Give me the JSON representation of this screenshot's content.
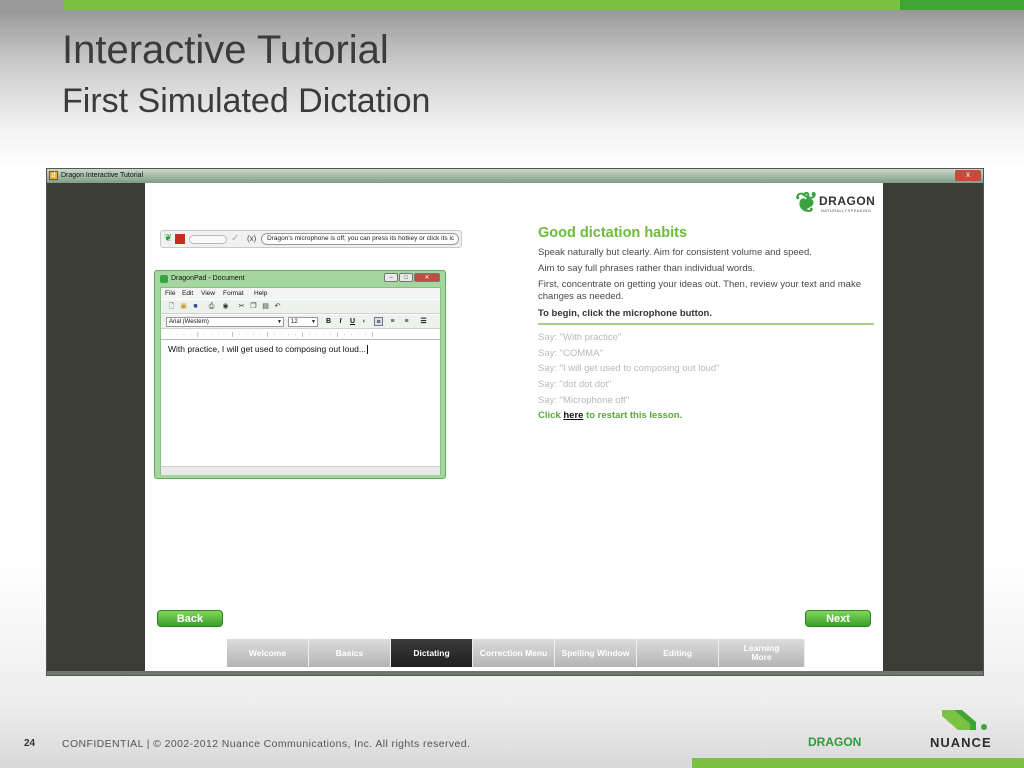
{
  "slide": {
    "title": "Interactive Tutorial",
    "subtitle": "First Simulated Dictation",
    "page_number": "24",
    "footer": "CONFIDENTIAL | © 2002-2012 Nuance Communications, Inc. All rights reserved.",
    "footer_brand": "DRAGON",
    "company": "NUANCE"
  },
  "window": {
    "title": "Dragon Interactive Tutorial",
    "close_label": "x"
  },
  "mic_bar": {
    "status_message": "Dragon's microphone is off; you can press its hotkey or click its ic",
    "x_label": "(x)"
  },
  "dragonpad": {
    "title": "DragonPad - Document",
    "menu": [
      "File",
      "Edit",
      "View",
      "Format",
      "Help"
    ],
    "font": "Arial (Western)",
    "font_size": "12",
    "format_buttons": [
      "B",
      "I",
      "U"
    ],
    "document_text": "With practice, I will get used to composing out loud..."
  },
  "logo": {
    "name": "DRAGON",
    "sub": "NATURALLYSPEAKING"
  },
  "instructions": {
    "title": "Good dictation habits",
    "lines": [
      "Speak naturally but clearly.  Aim for consistent volume and speed.",
      "Aim to say full phrases rather than individual words.",
      "First, concentrate on getting your ideas out. Then, review your text and make changes as needed."
    ],
    "prompt": "To begin, click the microphone button.",
    "say_lines": [
      "Say: \"With practice\"",
      "Say: \"COMMA\"",
      "Say: \"I will get used to composing out loud\"",
      "Say: \"dot dot dot\"",
      "Say: \"Microphone off\""
    ],
    "restart_prefix": "Click ",
    "restart_link": "here",
    "restart_suffix": " to restart this lesson."
  },
  "nav": {
    "back": "Back",
    "next": "Next"
  },
  "tabs": [
    {
      "label": "Welcome",
      "active": false
    },
    {
      "label": "Basics",
      "active": false
    },
    {
      "label": "Dictating",
      "active": true
    },
    {
      "label": "Correction Menu",
      "active": false
    },
    {
      "label": "Spelling Window",
      "active": false
    },
    {
      "label": "Editing",
      "active": false
    },
    {
      "label": "Learning More",
      "active": false
    }
  ],
  "colors": {
    "brand_green": "#7cc242",
    "title_green": "#6cbc3b",
    "active_tab": "#2a2a2a"
  }
}
